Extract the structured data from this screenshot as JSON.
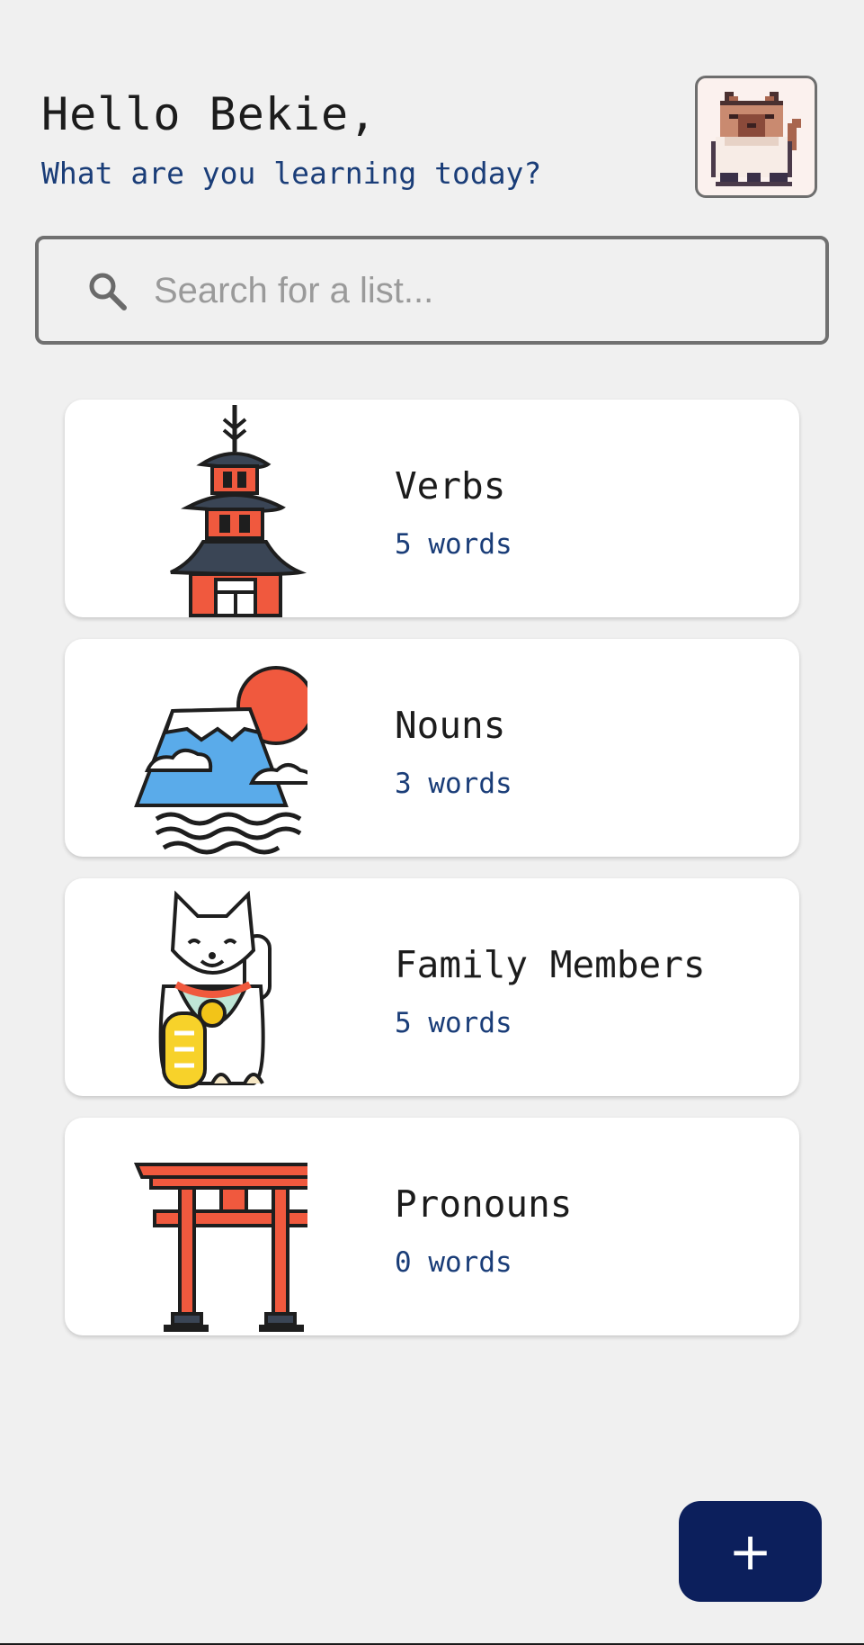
{
  "header": {
    "greeting": "Hello Bekie,",
    "subtitle": "What are you learning today?",
    "avatar_icon": "pixel-cat-icon"
  },
  "search": {
    "placeholder": "Search for a list...",
    "value": "",
    "icon": "search-icon"
  },
  "lists": [
    {
      "title": "Verbs",
      "count": "5 words",
      "icon": "pagoda-icon"
    },
    {
      "title": "Nouns",
      "count": "3 words",
      "icon": "mount-fuji-icon"
    },
    {
      "title": "Family Members",
      "count": "5 words",
      "icon": "lucky-cat-icon"
    },
    {
      "title": "Pronouns",
      "count": "0 words",
      "icon": "torii-gate-icon"
    }
  ],
  "fab": {
    "label": "+",
    "icon": "add-icon"
  },
  "colors": {
    "background": "#f0f0f0",
    "accent": "#0c1f5c",
    "subtitle_text": "#1a3d78",
    "icon_red": "#f0593e",
    "icon_navy": "#3a4555",
    "icon_blue": "#5aabea"
  }
}
